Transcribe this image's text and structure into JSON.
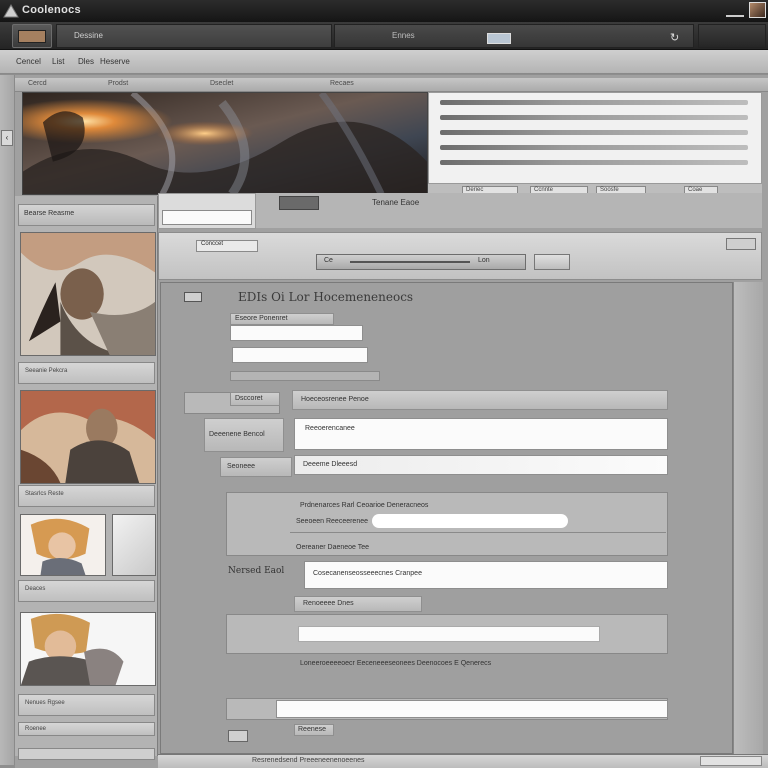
{
  "app": {
    "title": "Coolenocs"
  },
  "toolbar": {
    "tab_a_label": "Dessine",
    "tab_b_label": "Ennes",
    "refresh_glyph": "↻"
  },
  "menu": {
    "items": [
      "Cencel",
      "List",
      "Dles",
      "Heserve"
    ]
  },
  "top_strip": {
    "labels": [
      "Cercd",
      "Prodst",
      "Dseclet",
      "Recaes"
    ]
  },
  "hero_list": {
    "tabs": [
      "Deriec",
      "Ccnnte",
      "Soosfe",
      "Coae"
    ]
  },
  "sidebar": {
    "header": "Bearse Reasme",
    "captions": [
      "Seeanie Pekcra",
      "Stasrlcs Reste",
      "Deaces",
      "Nenues Rgsee"
    ],
    "bottom_label": "Roenee"
  },
  "util": {
    "label": "Tenane Eaoe"
  },
  "dialog_header": {
    "chip": "Conccet",
    "field_label": "Ce",
    "field_value": "Lon"
  },
  "form": {
    "heading": "EDIs Oi Lor Hocemeneneocs",
    "fields": {
      "f1_label": "Eseore Ponenret",
      "row_label_1": "Dsccoret",
      "row_value_1": "Hoeceosrenee Penoe",
      "row_label_2": "Deeenene Bencol",
      "row_value_2": "Reeoerencanee",
      "row_label_3": "Seoneee",
      "row_value_3": "Deeeme Dleeesd",
      "group_title": "Prdnenarces Rarl Ceoarioe Deneracneos",
      "group_line_1": "Seeoeen Reeceerenee",
      "group_line_2": "Oereaner Daeneoe   Tee",
      "nav_label": "Nersed Eaol",
      "nav_value": "Cosecanenseosseeecnes Cranpee",
      "combo_label": "Renoeeee Dnes",
      "long_text": "Loneeroeeeeoecr Eeceneeeseonees Deenocoes E Qenerecs",
      "ok_label": "Reenese",
      "status_label": "Resrenedsend Preeeneenenoeenes"
    }
  },
  "colors": {
    "titlebar": "#1d1d1d",
    "panel": "#a0a0a0",
    "accent": "#2b3c56"
  }
}
